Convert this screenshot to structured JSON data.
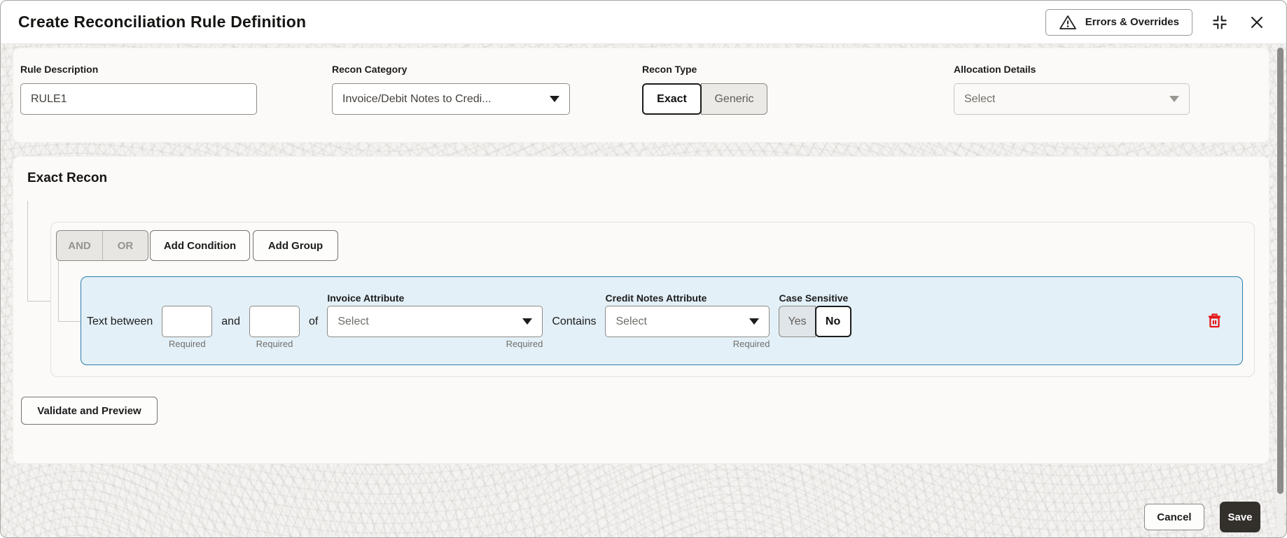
{
  "header": {
    "title": "Create Reconciliation Rule Definition",
    "errors_overrides_label": "Errors & Overrides",
    "warning_icon": "warning-triangle",
    "collapse_icon": "collapse-corners",
    "close_icon": "close-x"
  },
  "form": {
    "rule_description": {
      "label": "Rule Description",
      "value": "RULE1"
    },
    "recon_category": {
      "label": "Recon Category",
      "value": "Invoice/Debit Notes to Credi..."
    },
    "recon_type": {
      "label": "Recon Type",
      "options": [
        "Exact",
        "Generic"
      ],
      "selected": "Exact"
    },
    "allocation_details": {
      "label": "Allocation Details",
      "placeholder": "Select",
      "disabled": true
    }
  },
  "recon_section": {
    "title": "Exact Recon",
    "group": {
      "and_label": "AND",
      "or_label": "OR",
      "add_condition_label": "Add Condition",
      "add_group_label": "Add Group"
    },
    "condition": {
      "prefix_text": "Text between",
      "start_index": {
        "value": "",
        "required_hint": "Required"
      },
      "and_text": "and",
      "end_index": {
        "value": "",
        "required_hint": "Required"
      },
      "of_text": "of",
      "invoice_attribute": {
        "label": "Invoice Attribute",
        "placeholder": "Select",
        "required_hint": "Required"
      },
      "operator_text": "Contains",
      "credit_notes_attribute": {
        "label": "Credit Notes Attribute",
        "placeholder": "Select",
        "required_hint": "Required"
      },
      "case_sensitive": {
        "label": "Case Sensitive",
        "options": [
          "Yes",
          "No"
        ],
        "selected": "No"
      },
      "delete_icon": "trash"
    },
    "validate_button_label": "Validate and Preview"
  },
  "footer": {
    "cancel_label": "Cancel",
    "save_label": "Save"
  },
  "colors": {
    "condition_row_bg": "#e3f0f8",
    "condition_row_border": "#2e7da9",
    "danger_icon": "#e51616",
    "save_button_bg": "#33302c",
    "panel_bg": "#fbfaf8",
    "body_bg": "#f4f3f1"
  }
}
